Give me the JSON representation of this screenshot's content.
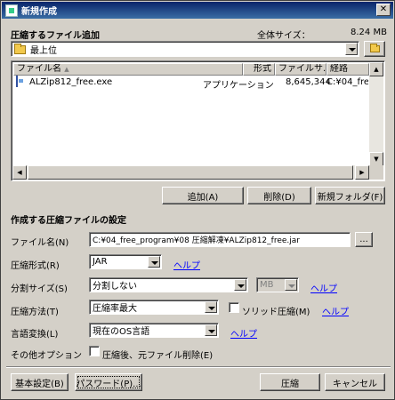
{
  "window": {
    "title": "新規作成"
  },
  "add_section": {
    "heading": "圧縮するファイル追加",
    "total_size_label": "全体サイズ：",
    "total_size_value": "8.24 MB",
    "location": "最上位"
  },
  "file_list": {
    "columns": [
      "ファイル名",
      "形式",
      "ファイルサ...",
      "経路"
    ],
    "rows": [
      {
        "name": "ALZip812_free.exe",
        "type": "アプリケーション",
        "size": "8,645,344",
        "path": "C:¥04_free_progra"
      }
    ]
  },
  "list_buttons": {
    "add": "追加(A)",
    "delete": "削除(D)",
    "new_folder": "新規フォルダ(F)"
  },
  "settings": {
    "heading": "作成する圧縮ファイルの設定",
    "filename_label": "ファイル名(N)",
    "filename_value": "C:¥04_free_program¥08 圧縮解凍¥ALZip812_free.jar",
    "browse": "...",
    "format_label": "圧縮形式(R)",
    "format_value": "JAR",
    "split_label": "分割サイズ(S)",
    "split_value": "分割しない",
    "split_unit": "MB",
    "method_label": "圧縮方法(T)",
    "method_value": "圧縮率最大",
    "solid_label": "ソリッド圧縮(M)",
    "lang_label": "言語変換(L)",
    "lang_value": "現在のOS言語",
    "other_label": "その他オプション",
    "delete_after_label": "圧縮後、元ファイル削除(E)",
    "help": "ヘルプ"
  },
  "bottom_buttons": {
    "basic": "基本設定(B)",
    "password": "パスワード(P)...",
    "compress": "圧縮",
    "cancel": "キャンセル"
  }
}
